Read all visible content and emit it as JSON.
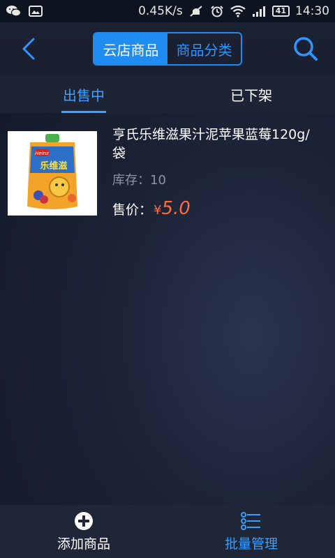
{
  "status_bar": {
    "speed": "0.45K/s",
    "battery": "41",
    "time": "14:30"
  },
  "header": {
    "segments": [
      {
        "label": "云店商品",
        "active": true
      },
      {
        "label": "商品分类",
        "active": false
      }
    ]
  },
  "tabs": [
    {
      "label": "出售中",
      "active": true
    },
    {
      "label": "已下架",
      "active": false
    }
  ],
  "products": [
    {
      "name": "亨氏乐维滋果汁泥苹果蓝莓120g/袋",
      "stock_label": "库存：",
      "stock": "10",
      "price_label": "售价：",
      "currency": "¥",
      "price": "5.0",
      "image_brand": "Heinz",
      "image_title": "乐维滋"
    }
  ],
  "bottom_bar": {
    "add_label": "添加商品",
    "batch_label": "批量管理"
  },
  "colors": {
    "accent": "#1e8cf0",
    "price": "#ff6a3c",
    "muted": "#8e96a6"
  }
}
